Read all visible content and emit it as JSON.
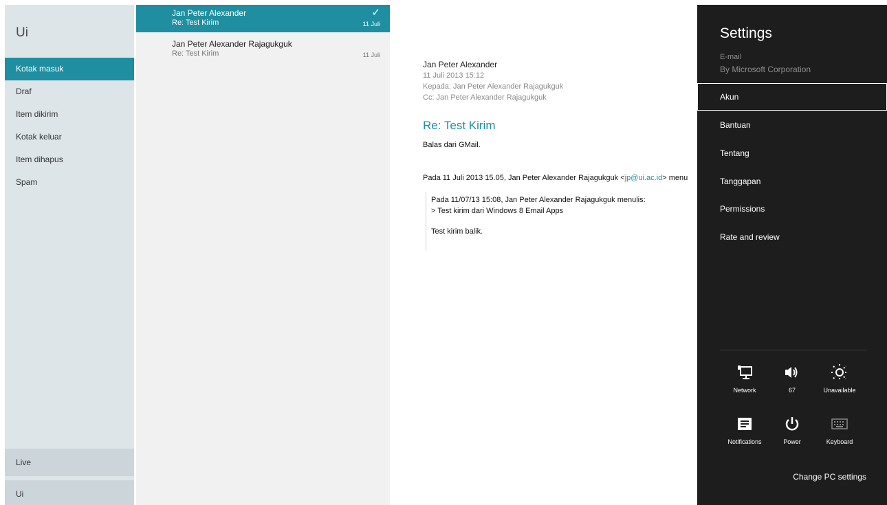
{
  "folders": {
    "account_title": "Ui",
    "items": [
      {
        "label": "Kotak masuk"
      },
      {
        "label": "Draf"
      },
      {
        "label": "Item dikirim"
      },
      {
        "label": "Kotak keluar"
      },
      {
        "label": "Item dihapus"
      },
      {
        "label": "Spam"
      }
    ],
    "accounts": [
      "Live",
      "Ui"
    ]
  },
  "messages": [
    {
      "from": "Jan Peter Alexander",
      "subject": "Re: Test Kirim",
      "date": "11 Juli",
      "selected": true
    },
    {
      "from": "Jan Peter Alexander Rajagukguk",
      "subject": "Re: Test Kirim",
      "date": "11 Juli",
      "selected": false
    }
  ],
  "reader": {
    "sender": "Jan Peter Alexander",
    "datetime": "11 Juli 2013  15:12",
    "to": "Kepada: Jan Peter Alexander Rajagukguk",
    "cc": "Cc: Jan Peter Alexander Rajagukguk",
    "subject": "Re: Test Kirim",
    "body_line": "Balas dari GMail.",
    "reply_prefix": "Pada 11 Juli 2013 15.05, Jan Peter Alexander Rajagukguk <",
    "reply_email": "jp@ui.ac.id",
    "reply_suffix": "> menu",
    "quote_line1": "Pada 11/07/13 15:08, Jan Peter Alexander Rajagukguk menulis:",
    "quote_line2": "> Test kirim dari Windows 8 Email Apps",
    "quote_line3": "Test kirim balik."
  },
  "settings": {
    "title": "Settings",
    "app_name": "E-mail",
    "publisher": "By Microsoft Corporation",
    "items": [
      {
        "label": "Akun"
      },
      {
        "label": "Bantuan"
      },
      {
        "label": "Tentang"
      },
      {
        "label": "Tanggapan"
      },
      {
        "label": "Permissions"
      },
      {
        "label": "Rate and review"
      }
    ],
    "quick": {
      "network": {
        "label": "Network",
        "icon": "network-icon"
      },
      "volume": {
        "label": "67",
        "icon": "volume-icon"
      },
      "brightness": {
        "label": "Unavailable",
        "icon": "brightness-icon"
      },
      "notifications": {
        "label": "Notifications",
        "icon": "notifications-icon"
      },
      "power": {
        "label": "Power",
        "icon": "power-icon"
      },
      "keyboard": {
        "label": "Keyboard",
        "icon": "keyboard-icon"
      }
    },
    "change_pc_settings": "Change PC settings"
  },
  "colors": {
    "accent": "#1f8ea0",
    "folder_bg": "#dde5e9",
    "list_bg": "#f1f1f1",
    "charm_bg": "#1d1d1d"
  }
}
